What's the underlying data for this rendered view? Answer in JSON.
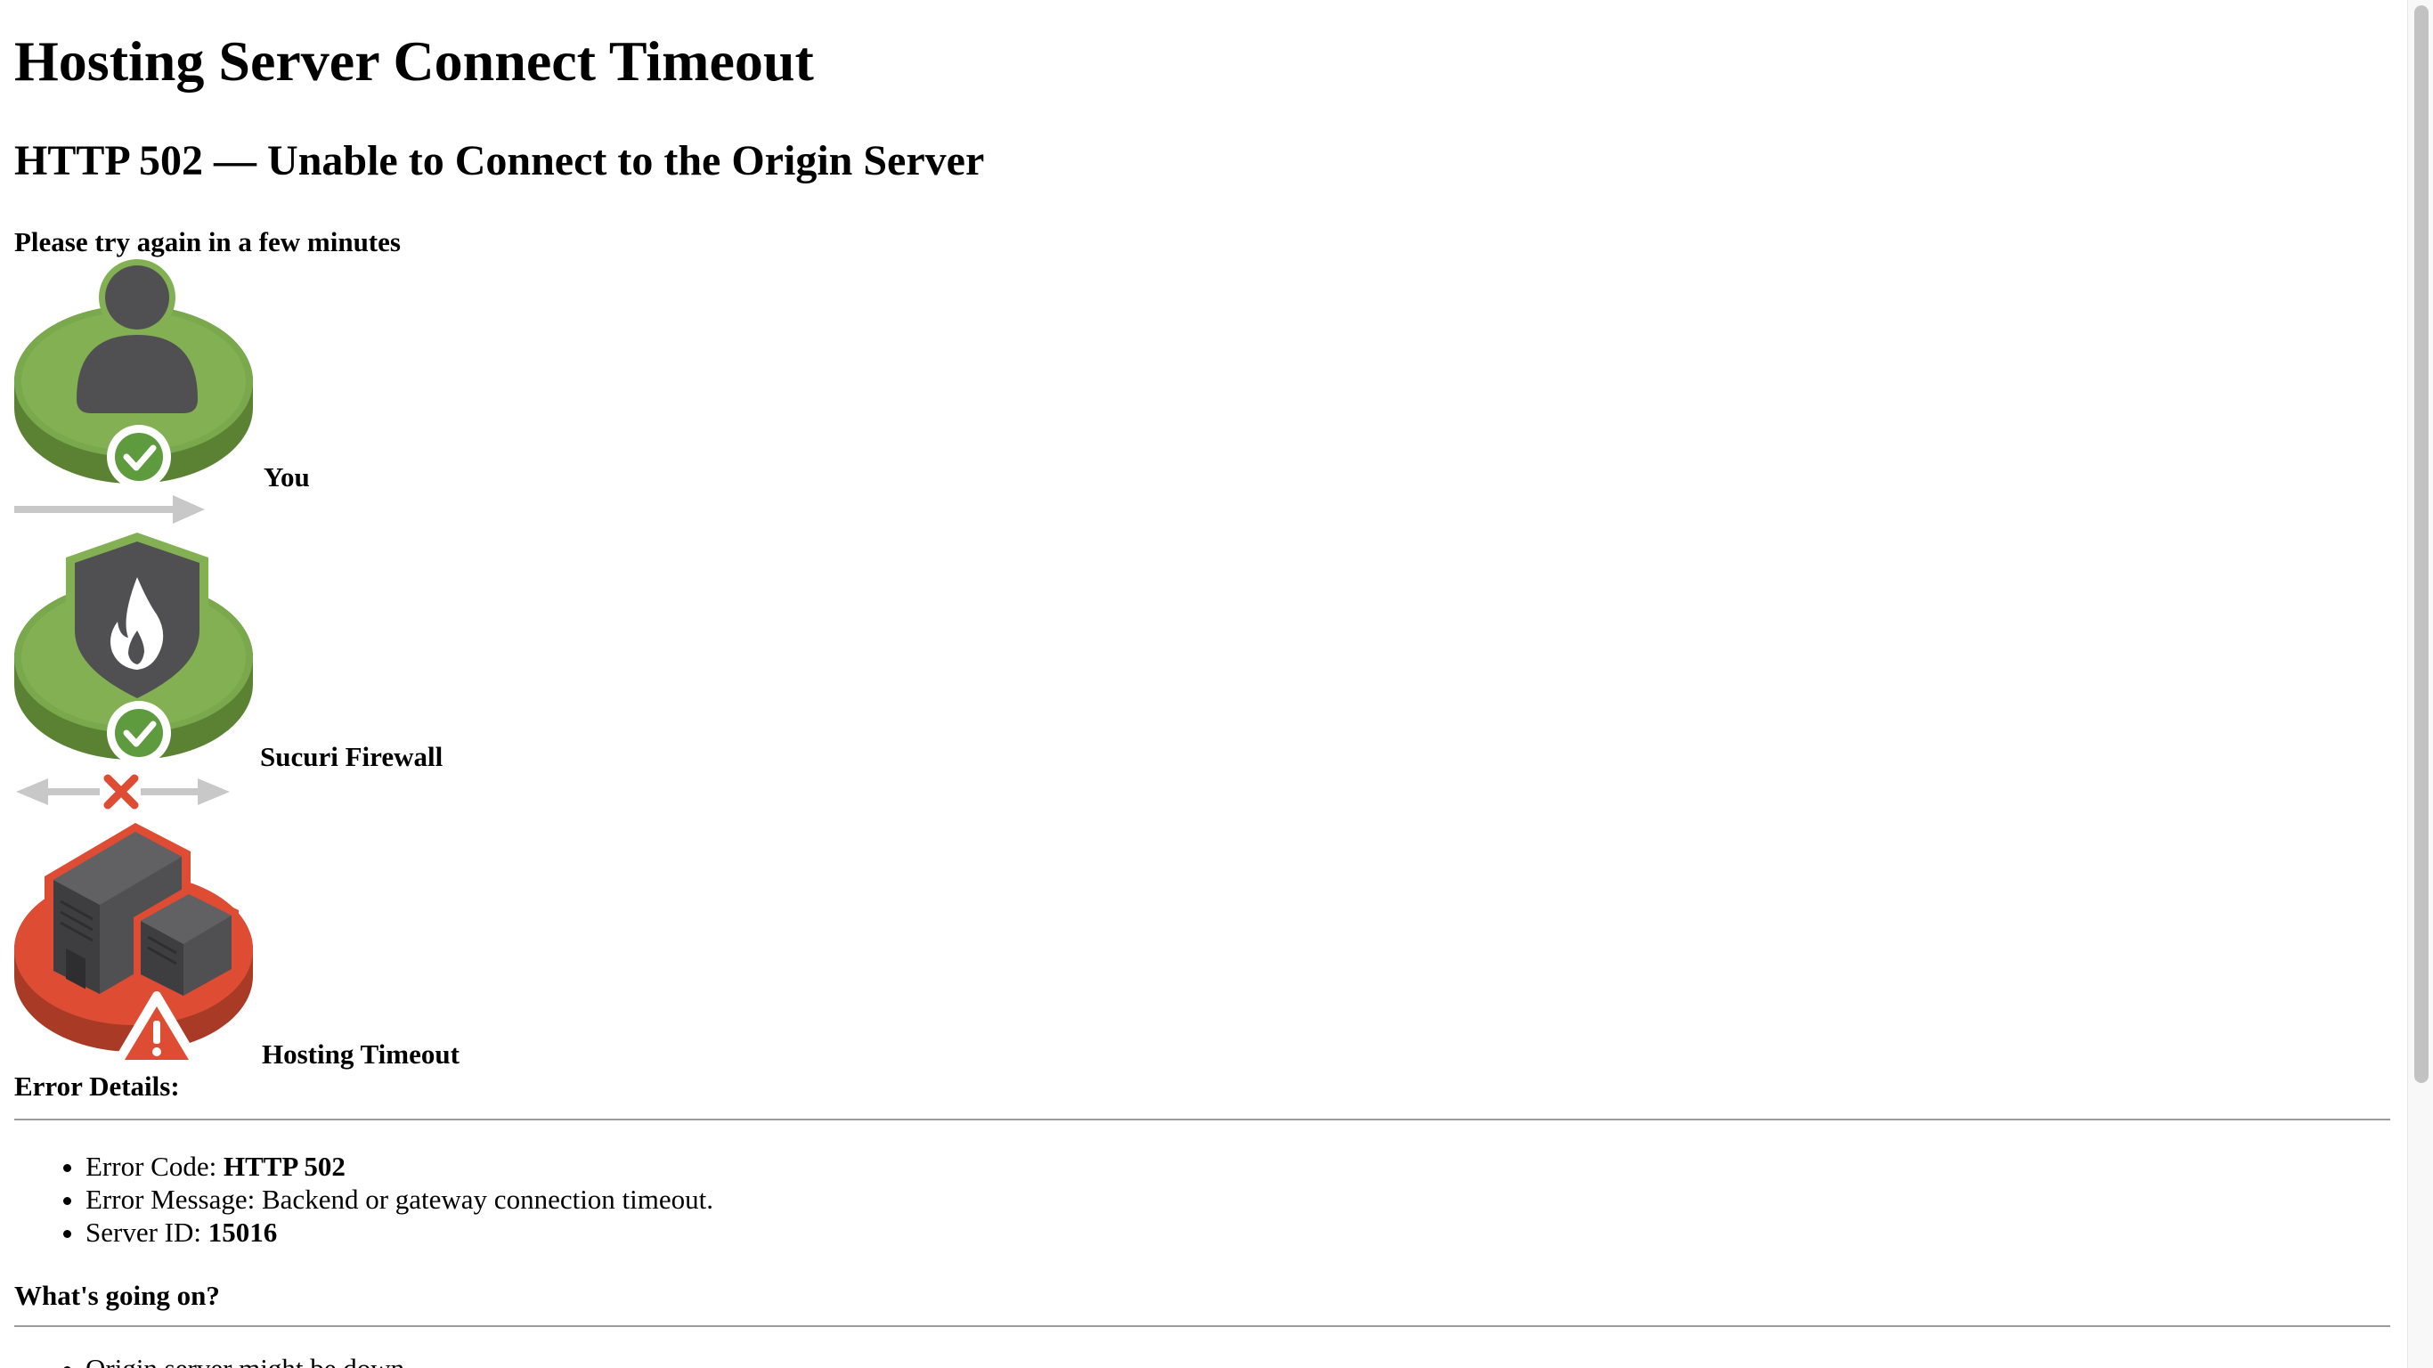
{
  "page": {
    "title": "Hosting Server Connect Timeout",
    "subtitle": "HTTP 502 — Unable to Connect to the Origin Server",
    "retry_text": "Please try again in a few minutes"
  },
  "diagram": {
    "nodes": [
      {
        "label": "You",
        "status": "ok",
        "icon": "user-icon",
        "color": "#7aa84c"
      },
      {
        "label": "Sucuri Firewall",
        "status": "ok",
        "icon": "firewall-shield-icon",
        "color": "#7aa84c"
      },
      {
        "label": "Hosting Timeout",
        "status": "error",
        "icon": "server-icon",
        "color": "#de4d33"
      }
    ],
    "connections": [
      {
        "from": "You",
        "to": "Sucuri Firewall",
        "state": "ok"
      },
      {
        "from": "Sucuri Firewall",
        "to": "Hosting Timeout",
        "state": "failed"
      }
    ]
  },
  "error_details": {
    "heading": "Error Details:",
    "items": [
      {
        "label": "Error Code: ",
        "value": "HTTP 502"
      },
      {
        "label": "Error Message: ",
        "value": "Backend or gateway connection timeout."
      },
      {
        "label": "Server ID: ",
        "value": "15016"
      }
    ]
  },
  "whats_going_on": {
    "heading": "What's going on?",
    "first_item_partial": "Origin server might be down"
  },
  "colors": {
    "ok_green": "#7aa84c",
    "error_red": "#de4d33",
    "icon_dark": "#505052",
    "arrow_gray": "#c8c8c8",
    "rule_gray": "#9a9a9a"
  }
}
